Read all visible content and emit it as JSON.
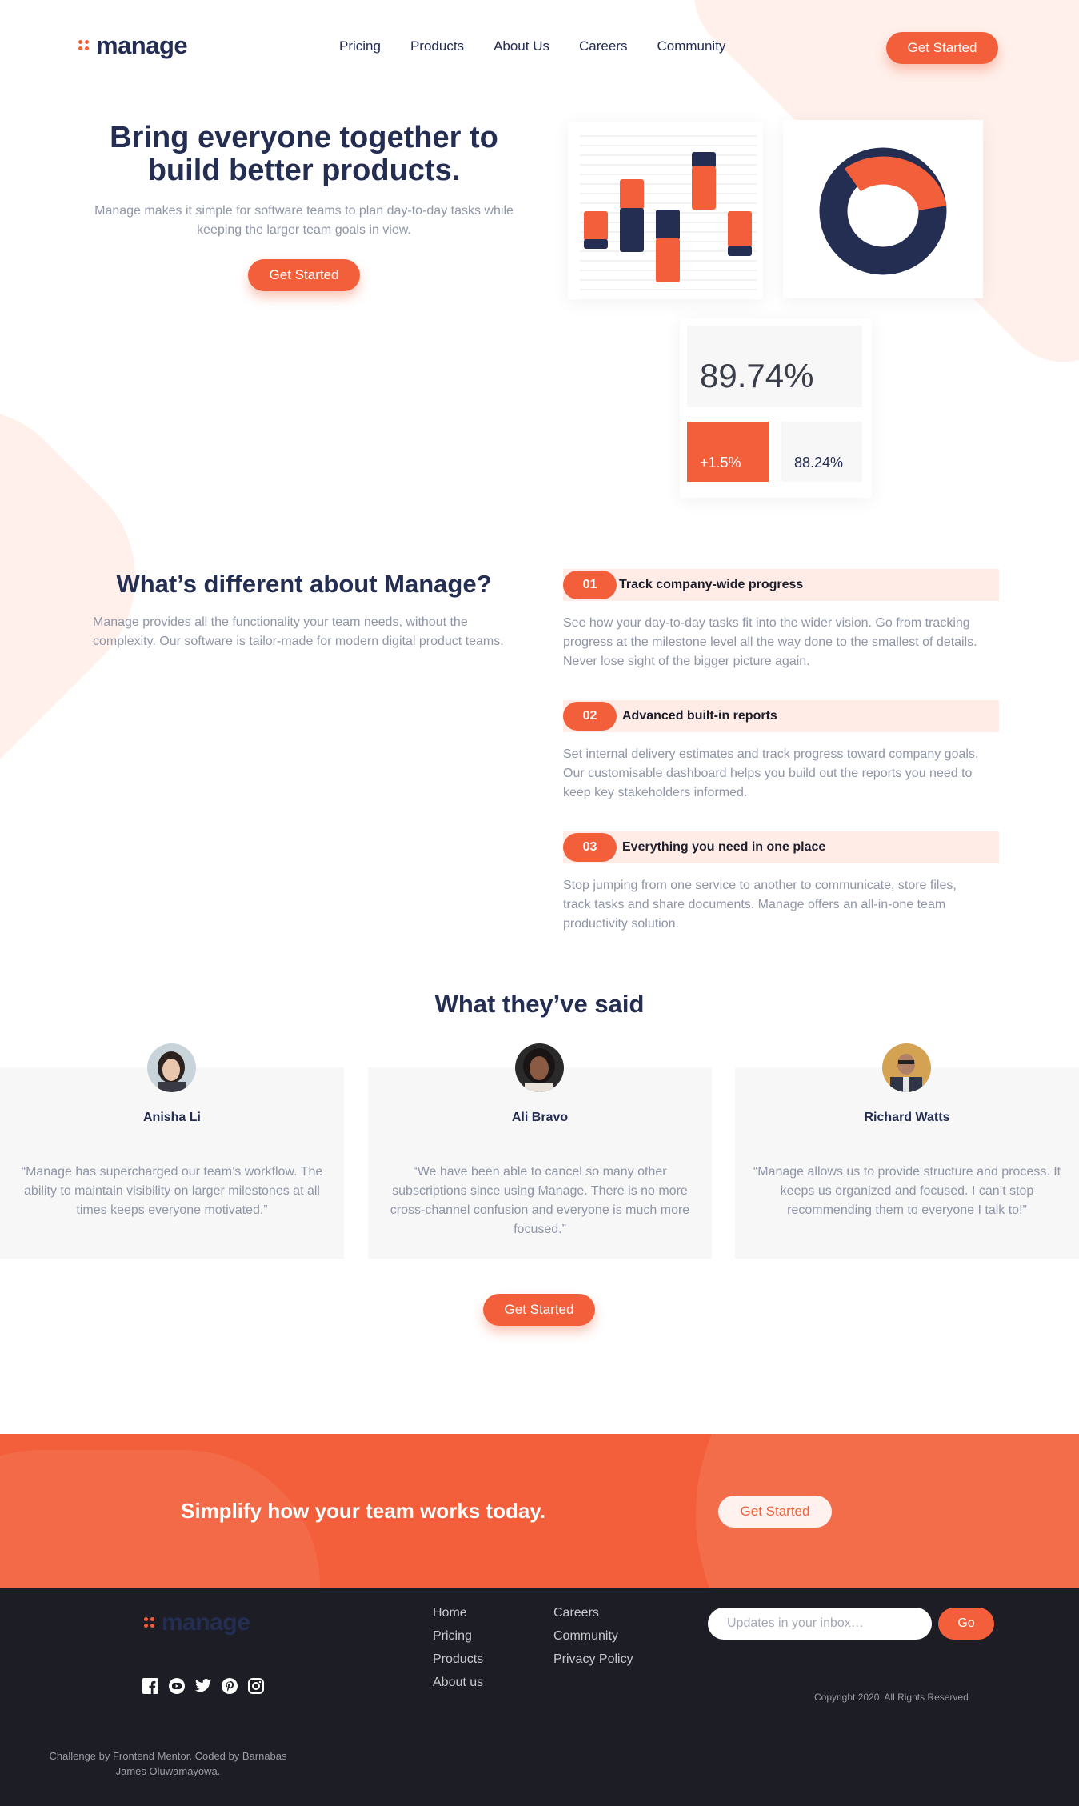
{
  "brand": {
    "name": "manage",
    "accent": "#f25f3a",
    "navy": "#242d52"
  },
  "header": {
    "nav": [
      "Pricing",
      "Products",
      "About Us",
      "Careers",
      "Community"
    ],
    "cta_label": "Get Started"
  },
  "hero": {
    "title": "Bring everyone together to build better products.",
    "subtitle": "Manage makes it simple for software teams to plan day-to-day tasks while keeping the larger team goals in view.",
    "cta_label": "Get Started"
  },
  "dashboard": {
    "main_stat": "89.74%",
    "change_stat": "+1.5%",
    "secondary_stat": "88.24%"
  },
  "features": {
    "title": "What’s different about Manage?",
    "description": "Manage provides all the functionality your team needs, without the complexity. Our software is tailor-made for modern digital product teams.",
    "items": [
      {
        "number": "01",
        "heading": "Track company-wide progress",
        "text": "See how your day-to-day tasks fit into the wider vision. Go from tracking progress at the milestone level all the way done to the smallest of details. Never lose sight of the bigger picture again."
      },
      {
        "number": "02",
        "heading": "Advanced built-in reports",
        "text": "Set internal delivery estimates and track progress toward company goals. Our customisable dashboard helps you build out the reports you need to keep key stakeholders informed."
      },
      {
        "number": "03",
        "heading": "Everything you need in one place",
        "text": "Stop jumping from one service to another to communicate, store files, track tasks and share documents. Manage offers an all-in-one team productivity solution."
      }
    ]
  },
  "testimonials": {
    "title": "What they’ve said",
    "items": [
      {
        "name": "Anisha Li",
        "quote": "“Manage has supercharged our team’s workflow. The ability to maintain visibility on larger milestones at all times keeps everyone motivated.”"
      },
      {
        "name": "Ali Bravo",
        "quote": "“We have been able to cancel so many other subscriptions since using Manage. There is no more cross-channel confusion and everyone is much more focused.”"
      },
      {
        "name": "Richard Watts",
        "quote": "“Manage allows us to provide structure and process. It keeps us organized and focused. I can’t stop recommending them to everyone I talk to!”"
      }
    ],
    "cta_label": "Get Started"
  },
  "cta": {
    "text": "Simplify how your team works today.",
    "button_label": "Get Started"
  },
  "footer": {
    "links_col1": [
      "Home",
      "Pricing",
      "Products",
      "About us"
    ],
    "links_col2": [
      "Careers",
      "Community",
      "Privacy Policy"
    ],
    "newsletter_placeholder": "Updates in your inbox…",
    "go_label": "Go",
    "copyright": "Copyright 2020. All Rights Reserved",
    "attribution": "Challenge by Frontend Mentor. Coded by Barnabas James Oluwamayowa.",
    "social_icons": [
      "facebook-icon",
      "youtube-icon",
      "twitter-icon",
      "pinterest-icon",
      "instagram-icon"
    ]
  }
}
